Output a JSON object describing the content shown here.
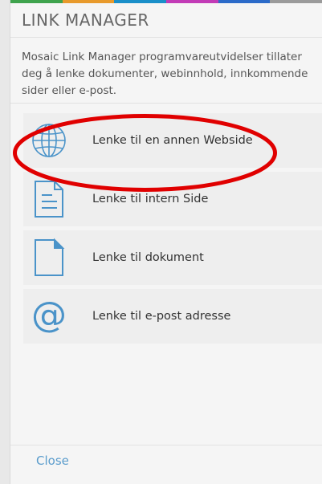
{
  "header": {
    "title": "LINK MANAGER"
  },
  "description": "Mosaic Link Manager programvareutvidelser tillater deg å lenke dokumenter, webinnhold, innkommende sider eller e-post.",
  "items": [
    {
      "label": "Lenke til en annen Webside",
      "icon": "globe-icon"
    },
    {
      "label": "Lenke til intern Side",
      "icon": "document-lines-icon"
    },
    {
      "label": "Lenke til dokument",
      "icon": "document-icon"
    },
    {
      "label": "Lenke til e-post adresse",
      "icon": "at-sign-icon"
    }
  ],
  "footer": {
    "close_label": "Close"
  },
  "colors": {
    "accent": "#4a93c9",
    "close_link": "#5a9ccc",
    "annotation": "#e00000",
    "strip": [
      "#3fa34d",
      "#e89a2c",
      "#1a8fc9",
      "#c23bb6",
      "#2c6bc9",
      "#9b9b9b"
    ]
  }
}
